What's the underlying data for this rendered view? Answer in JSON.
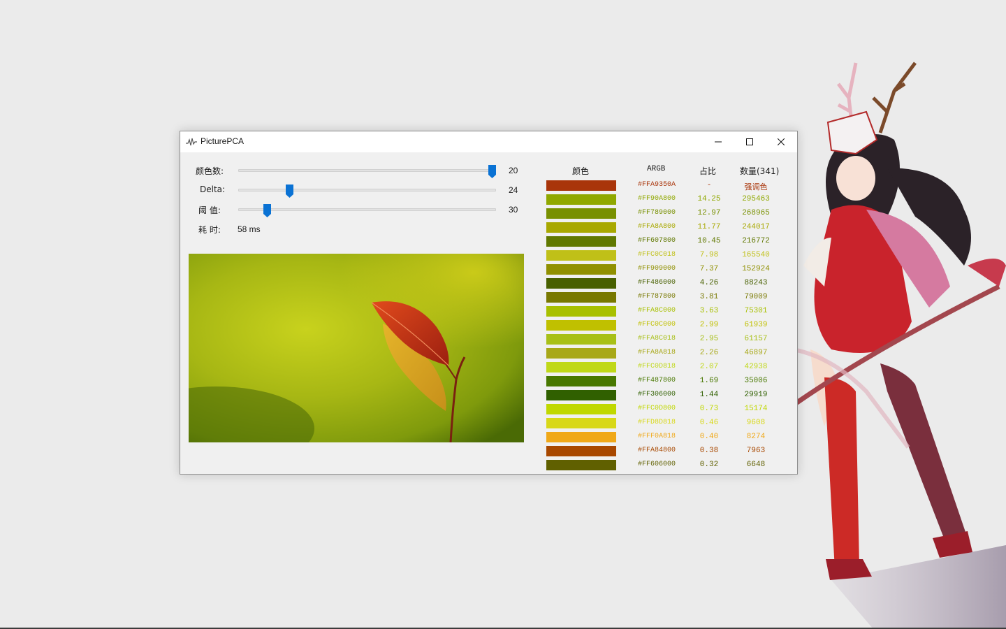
{
  "window": {
    "title": "PicturePCA"
  },
  "controls": {
    "color_count": {
      "label": "颜色数:",
      "value": "20",
      "fraction": 1.0
    },
    "delta": {
      "label": "Delta:",
      "value": "24",
      "fraction": 0.19
    },
    "threshold": {
      "label": "阈 值:",
      "value": "30",
      "fraction": 0.1
    },
    "elapsed": {
      "label": "耗 时:",
      "value": "58 ms"
    }
  },
  "table": {
    "headers": {
      "color": "颜色",
      "argb": "ARGB",
      "ratio": "占比",
      "count": "数量(341)"
    },
    "rows": [
      {
        "color": "#A9350A",
        "argb": "#FFA9350A",
        "ratio": "-",
        "count": "强调色"
      },
      {
        "color": "#90A800",
        "argb": "#FF90A800",
        "ratio": "14.25",
        "count": "295463"
      },
      {
        "color": "#789000",
        "argb": "#FF789000",
        "ratio": "12.97",
        "count": "268965"
      },
      {
        "color": "#A8A800",
        "argb": "#FFA8A800",
        "ratio": "11.77",
        "count": "244017"
      },
      {
        "color": "#607800",
        "argb": "#FF607800",
        "ratio": "10.45",
        "count": "216772"
      },
      {
        "color": "#C0C018",
        "argb": "#FFC0C018",
        "ratio": "7.98",
        "count": "165540"
      },
      {
        "color": "#909000",
        "argb": "#FF909000",
        "ratio": "7.37",
        "count": "152924"
      },
      {
        "color": "#486000",
        "argb": "#FF486000",
        "ratio": "4.26",
        "count": "88243"
      },
      {
        "color": "#787800",
        "argb": "#FF787800",
        "ratio": "3.81",
        "count": "79009"
      },
      {
        "color": "#A8C000",
        "argb": "#FFA8C000",
        "ratio": "3.63",
        "count": "75301"
      },
      {
        "color": "#C0C000",
        "argb": "#FFC0C000",
        "ratio": "2.99",
        "count": "61939"
      },
      {
        "color": "#A8C018",
        "argb": "#FFA8C018",
        "ratio": "2.95",
        "count": "61157"
      },
      {
        "color": "#A8A818",
        "argb": "#FFA8A818",
        "ratio": "2.26",
        "count": "46897"
      },
      {
        "color": "#C0D818",
        "argb": "#FFC0D818",
        "ratio": "2.07",
        "count": "42938"
      },
      {
        "color": "#487800",
        "argb": "#FF487800",
        "ratio": "1.69",
        "count": "35006"
      },
      {
        "color": "#306000",
        "argb": "#FF306000",
        "ratio": "1.44",
        "count": "29919"
      },
      {
        "color": "#C0D800",
        "argb": "#FFC0D800",
        "ratio": "0.73",
        "count": "15174"
      },
      {
        "color": "#D8D818",
        "argb": "#FFD8D818",
        "ratio": "0.46",
        "count": "9608"
      },
      {
        "color": "#F0A818",
        "argb": "#FFF0A818",
        "ratio": "0.40",
        "count": "8274"
      },
      {
        "color": "#A84800",
        "argb": "#FFA84800",
        "ratio": "0.38",
        "count": "7963"
      },
      {
        "color": "#606000",
        "argb": "#FF606000",
        "ratio": "0.32",
        "count": "6648"
      }
    ]
  }
}
